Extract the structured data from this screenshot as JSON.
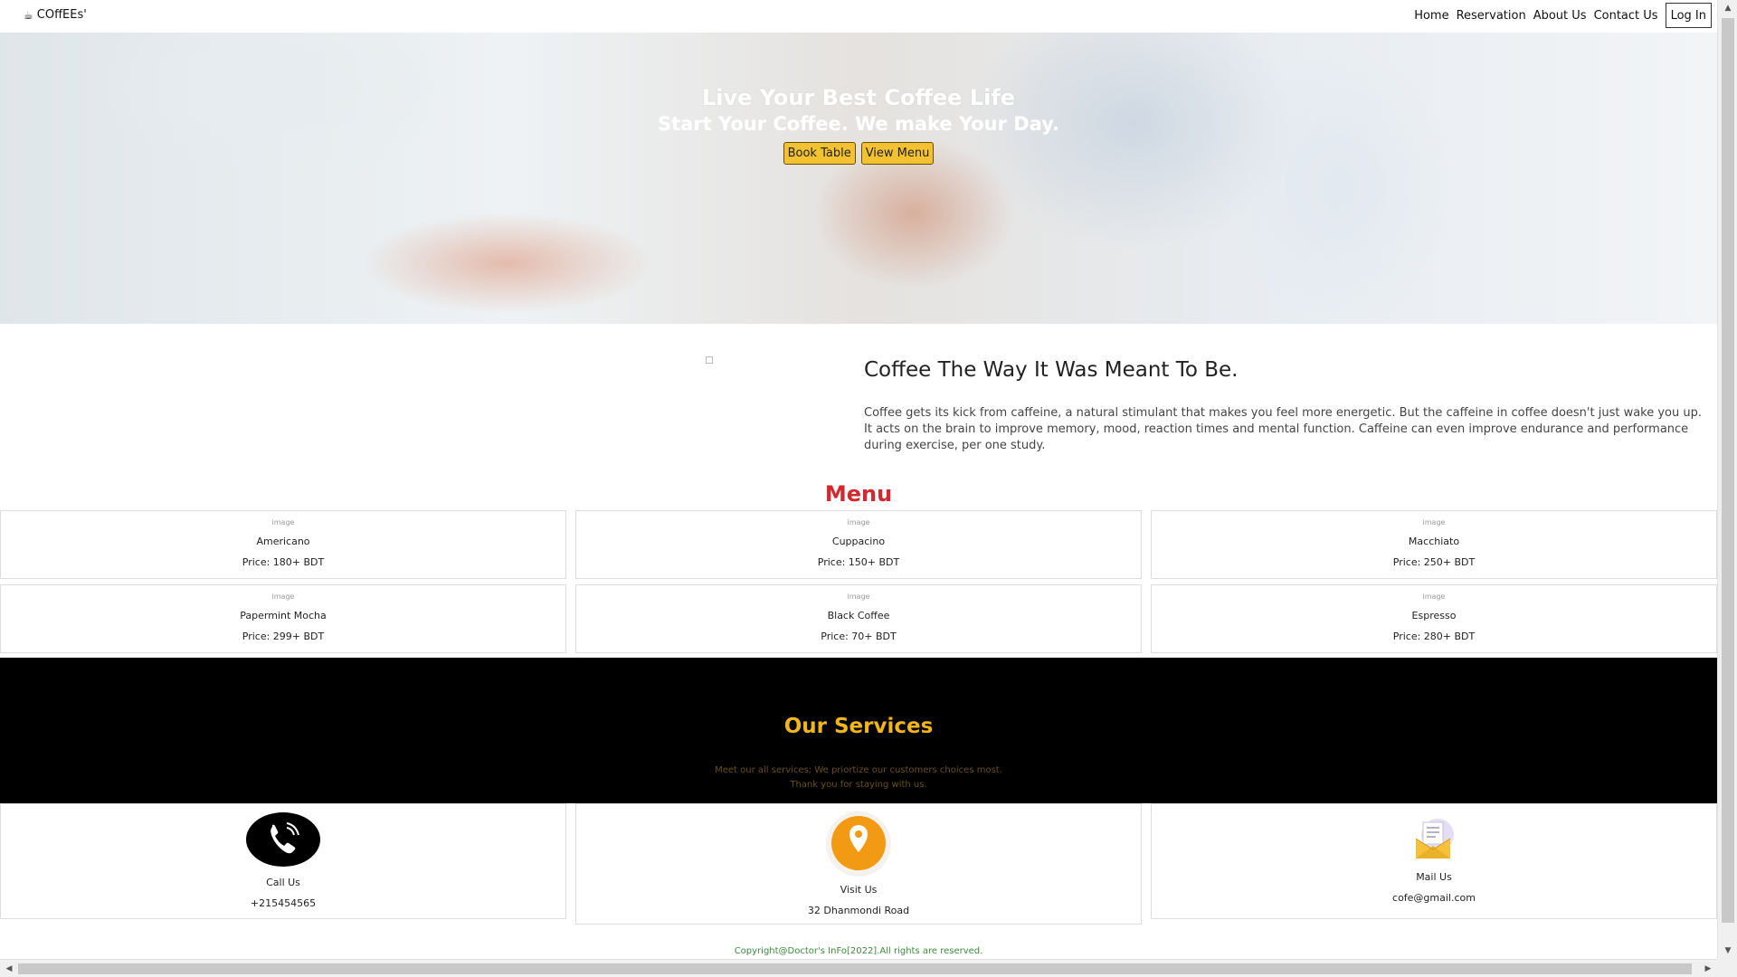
{
  "navbar": {
    "brand": "COffEEs'",
    "brand_icon": "coffee-cup-icon",
    "links": [
      "Home",
      "Reservation",
      "About Us",
      "Contact Us"
    ],
    "login": "Log In"
  },
  "hero": {
    "title": "Live Your Best Coffee Life",
    "subtitle": "Start Your Coffee. We make Your Day.",
    "book_btn": "Book Table",
    "menu_btn": "View Menu"
  },
  "about": {
    "title": "Coffee The Way It Was Meant To Be.",
    "text": "Coffee gets its kick from caffeine, a natural stimulant that makes you feel more energetic. But the caffeine in coffee doesn't just wake you up. It acts on the brain to improve memory, mood, reaction times and mental function. Caffeine can even improve endurance and performance during exercise, per one study."
  },
  "menu": {
    "title": "Menu",
    "image_alt": "image",
    "items": [
      {
        "name": "Americano",
        "price": "Price: 180+ BDT"
      },
      {
        "name": "Cuppacino",
        "price": "Price: 150+ BDT"
      },
      {
        "name": "Macchiato",
        "price": "Price: 250+ BDT"
      },
      {
        "name": "Papermint Mocha",
        "price": "Price: 299+ BDT"
      },
      {
        "name": "Black Coffee",
        "price": "Price: 70+ BDT"
      },
      {
        "name": "Espresso",
        "price": "Price: 280+ BDT"
      }
    ]
  },
  "services": {
    "title": "Our Services",
    "sub_line1": "Meet our all services; We priortize our customers choices most.",
    "sub_line2": "Thank you for staying with us.",
    "items": [
      {
        "label": "Call Us",
        "value": "+215454565",
        "icon": "phone-icon"
      },
      {
        "label": "Visit Us",
        "value": "32 Dhanmondi Road",
        "icon": "location-pin-icon"
      },
      {
        "label": "Mail Us",
        "value": "cofe@gmail.com",
        "icon": "mail-envelope-icon"
      }
    ]
  },
  "footer": {
    "copyright": "Copyright@Doctor's InFo[2022].All rights are reserved."
  },
  "colors": {
    "menu_title": "#d2282e",
    "services_title": "#f2b51b",
    "hero_button": "#f3c233",
    "footer_text": "#3d8a3d"
  }
}
